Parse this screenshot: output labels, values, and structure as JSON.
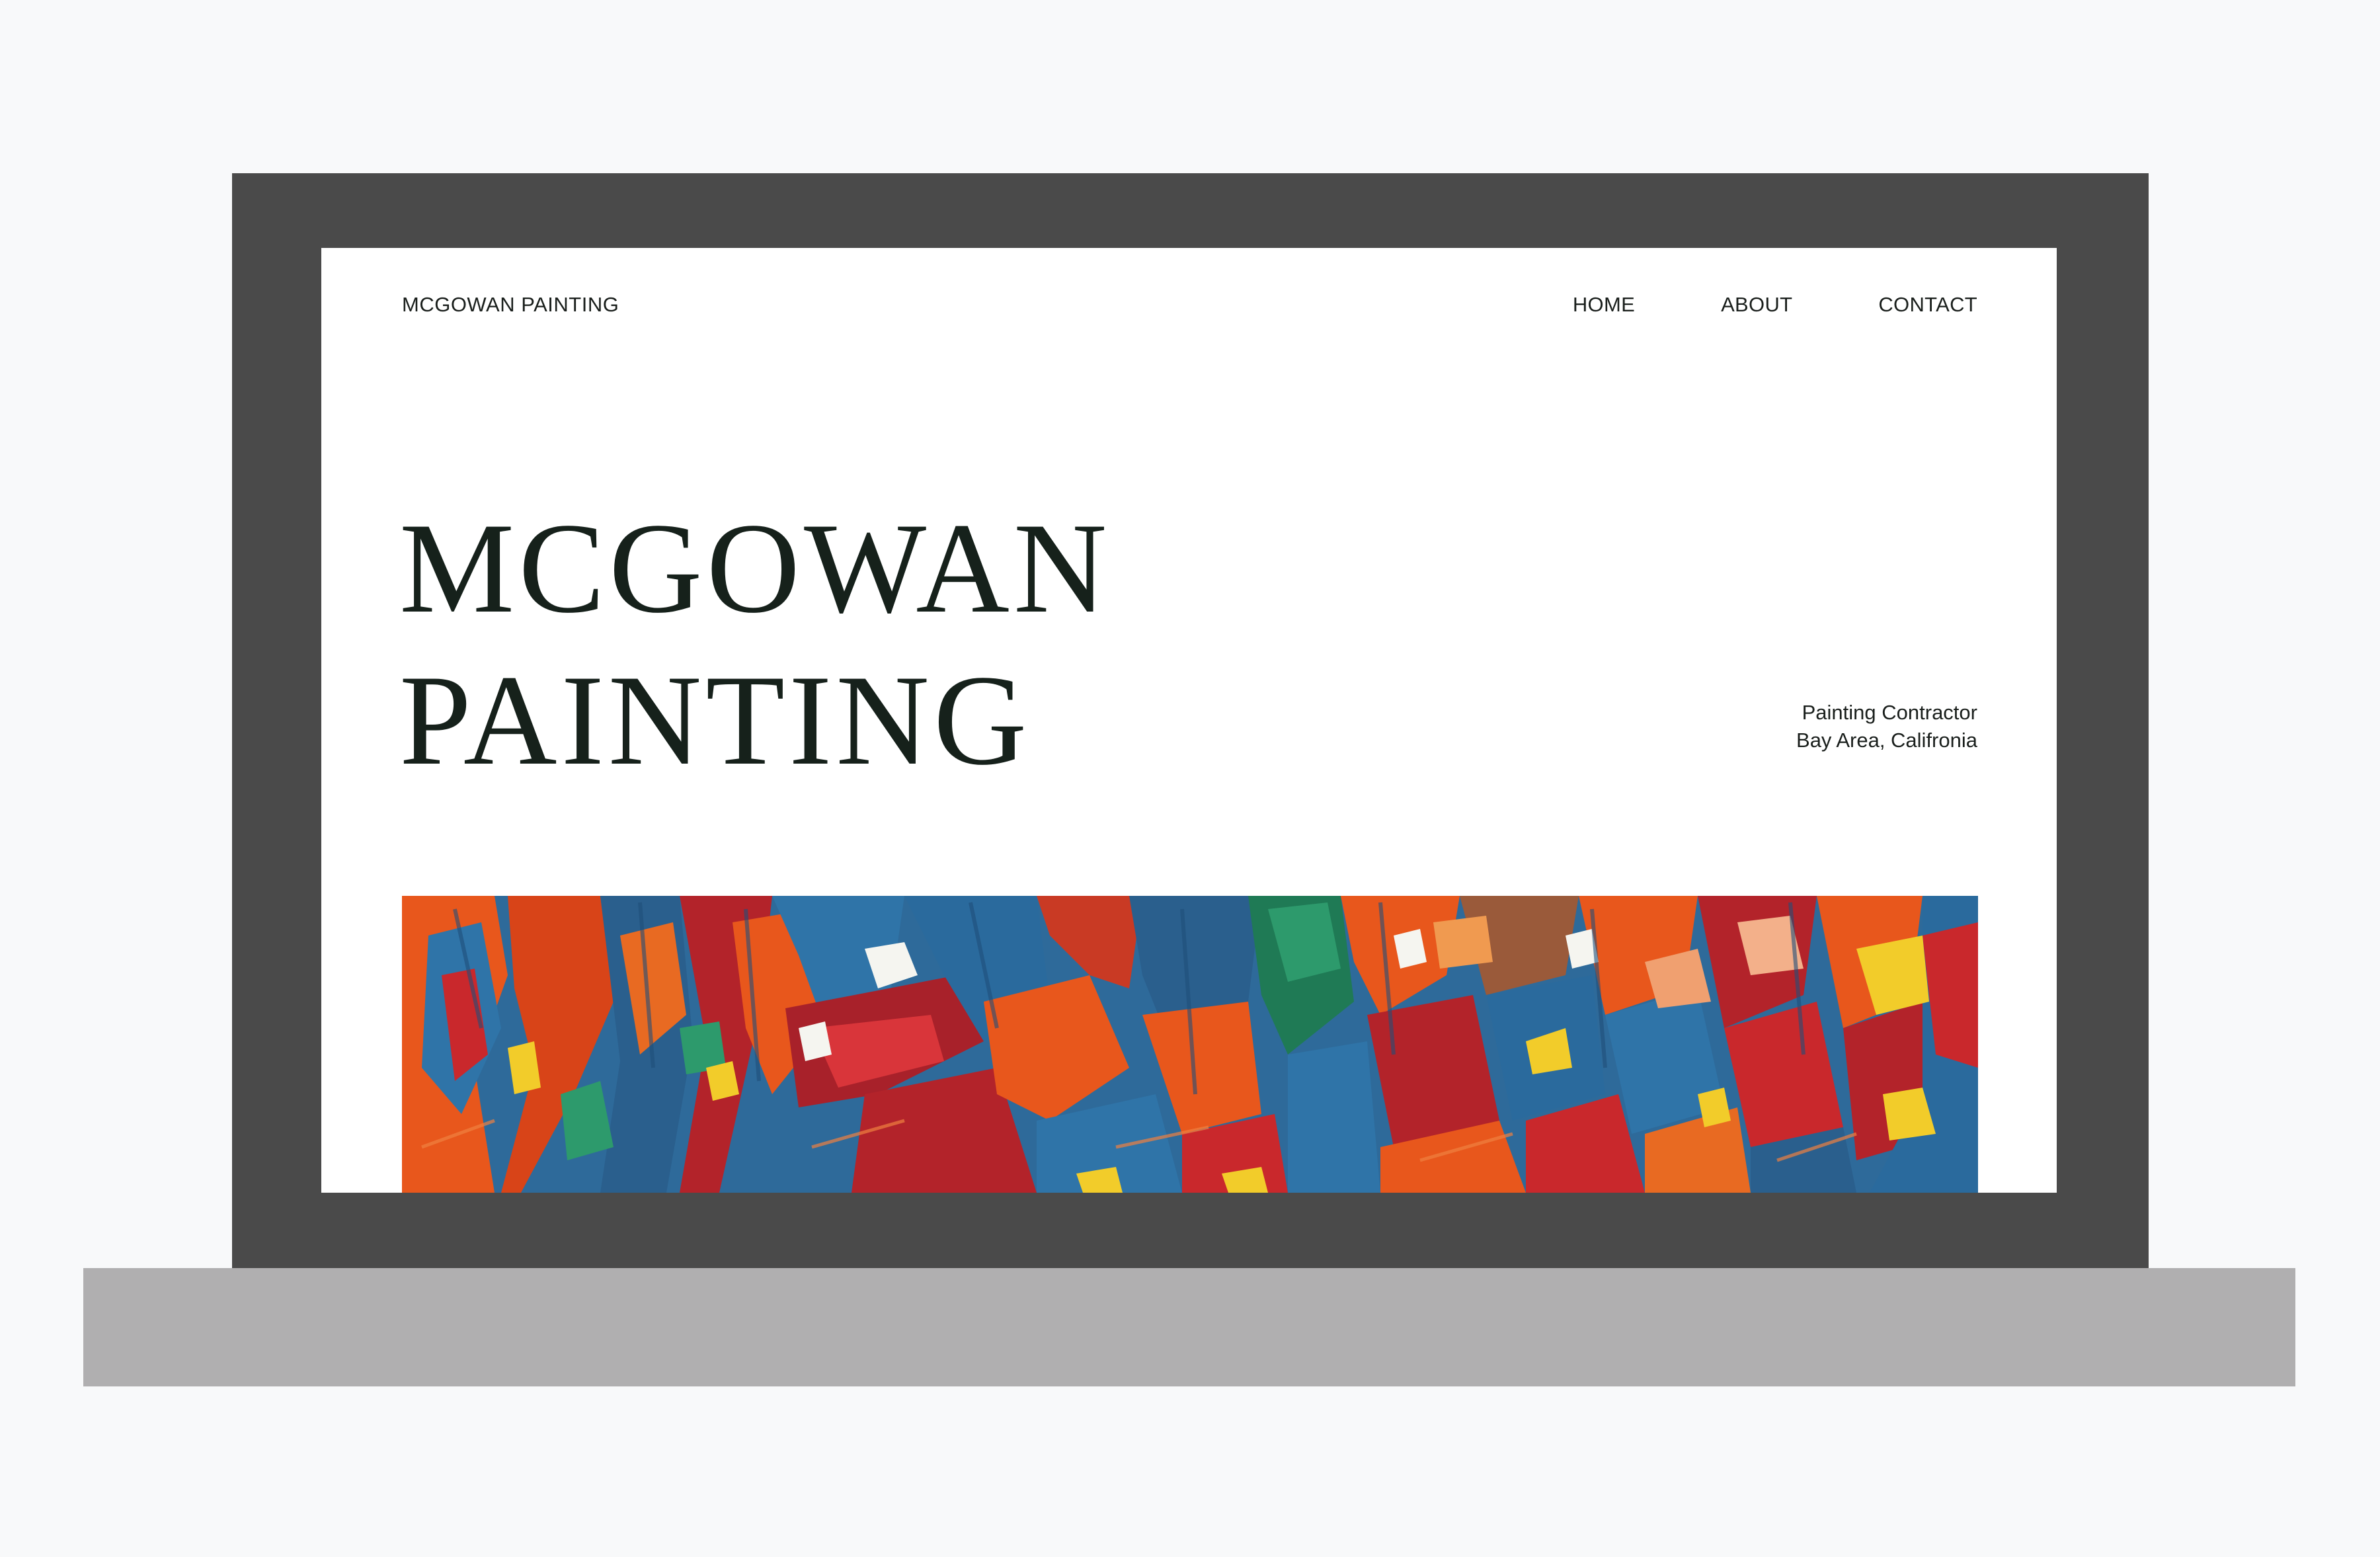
{
  "header": {
    "brand": "MCGOWAN PAINTING",
    "nav": [
      {
        "label": "HOME"
      },
      {
        "label": "ABOUT"
      },
      {
        "label": "CONTACT"
      }
    ]
  },
  "hero": {
    "title_line1": "MCGOWAN",
    "title_line2": "PAINTING",
    "tagline_line1": "Painting Contractor",
    "tagline_line2": "Bay Area, Califronia"
  },
  "colors": {
    "frame": "#4a4a4a",
    "base": "#b0afb0",
    "background": "#f8f9fa",
    "text": "#16211b",
    "paint_blue": "#2e6a9a",
    "paint_red": "#b3232a",
    "paint_orange": "#e8571c",
    "paint_yellow": "#f2cc2a",
    "paint_green": "#1f7a55"
  }
}
